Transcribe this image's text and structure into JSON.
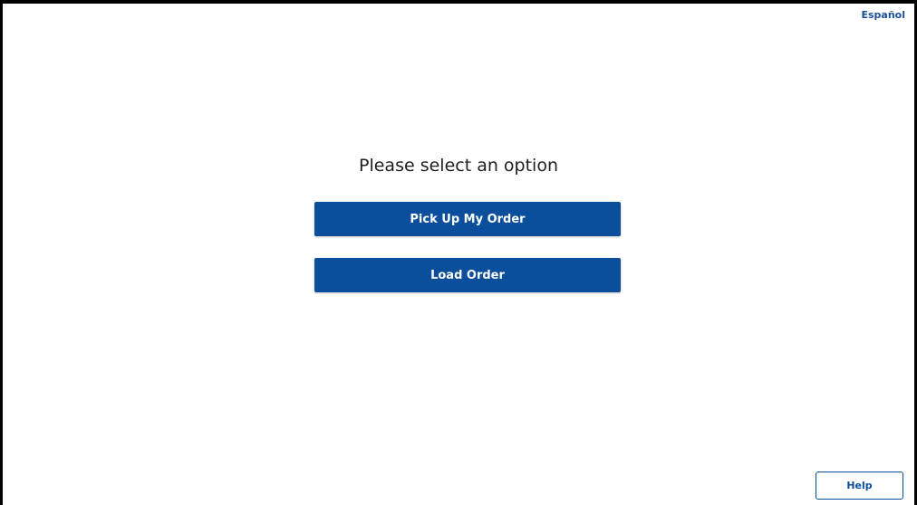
{
  "header": {
    "language_link": "Español"
  },
  "main": {
    "title": "Please select an option",
    "options": [
      {
        "label": "Pick Up My Order"
      },
      {
        "label": "Load Order"
      }
    ]
  },
  "footer": {
    "help_label": "Help"
  },
  "colors": {
    "primary": "#0b4f9c",
    "link": "#1a4f9a",
    "background": "#ffffff",
    "text": "#1f1f1f"
  }
}
